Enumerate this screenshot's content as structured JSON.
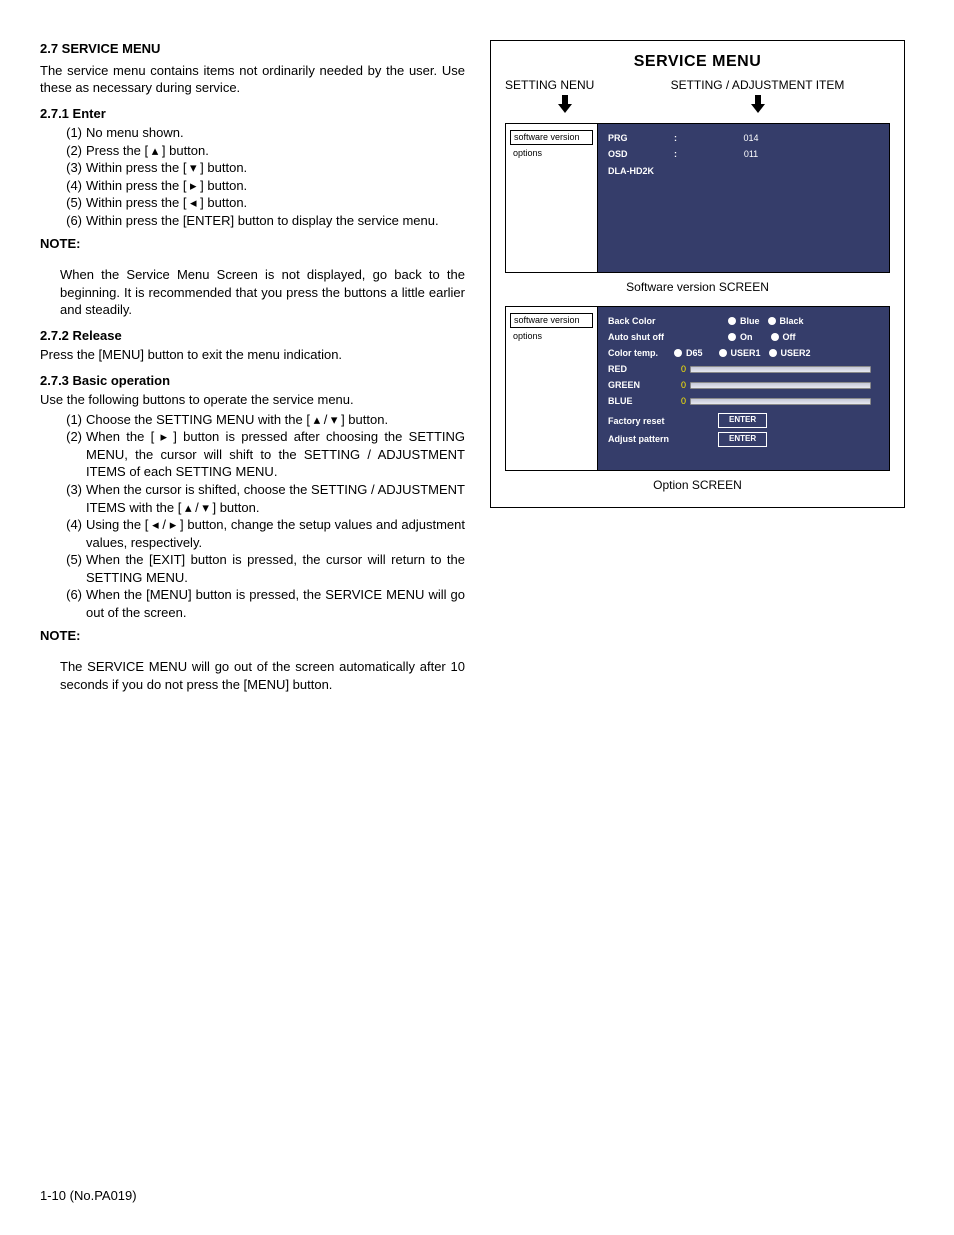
{
  "header": {
    "sec_num_title": "2.7   SERVICE MENU",
    "intro": "The service menu contains items not ordinarily needed by the user. Use these as necessary during service."
  },
  "sec271": {
    "title": "2.7.1   Enter",
    "steps": [
      "No menu shown.",
      "Press the [ ▴ ] button.",
      "Within press the [ ▾ ] button.",
      "Within press the [ ▸ ] button.",
      "Within press the [ ◂ ] button.",
      "Within press the [ENTER] button to display the service menu."
    ]
  },
  "note1": {
    "label": "NOTE:",
    "body": "When the Service Menu Screen is not displayed, go back to the beginning. It is recommended that you press the buttons a little earlier and steadily."
  },
  "sec272": {
    "title": "2.7.2   Release",
    "body": "Press the [MENU] button to exit the menu indication."
  },
  "sec273": {
    "title": "2.7.3   Basic operation",
    "lead": "Use the following buttons to operate the service menu.",
    "steps": [
      "Choose the SETTING MENU with the [ ▴ / ▾ ] button.",
      "When the [ ▸ ] button is pressed after choosing the SETTING MENU, the cursor will shift to the SETTING / ADJUSTMENT ITEMS of each SETTING MENU.",
      "When the cursor is shifted, choose the SETTING / ADJUSTMENT ITEMS with the [ ▴ / ▾ ] button.",
      "Using the [ ◂ / ▸ ] button, change the setup values and adjustment values, respectively.",
      "When the [EXIT] button is pressed, the cursor will return to the SETTING MENU.",
      "When the [MENU] button is pressed, the SERVICE MENU will go out of the screen."
    ]
  },
  "note2": {
    "label": "NOTE:",
    "body": "The SERVICE MENU will go out of the screen automatically after 10 seconds if you do not press the [MENU] button."
  },
  "footer": "1-10 (No.PA019)",
  "diagram": {
    "title": "SERVICE MENU",
    "col1": "SETTING NENU",
    "col2": "SETTING / ADJUSTMENT ITEM",
    "sidebar_items": [
      "software version",
      "options"
    ],
    "screen1": {
      "rows": [
        {
          "lbl": "PRG",
          "colon": ":",
          "val": "014"
        },
        {
          "lbl": "OSD",
          "colon": ":",
          "val": "011"
        },
        {
          "lbl": "DLA-HD2K",
          "colon": "",
          "val": ""
        }
      ],
      "caption": "Software version SCREEN"
    },
    "screen2": {
      "back_color": {
        "label": "Back Color",
        "opts": [
          "Blue",
          "Black"
        ]
      },
      "auto_shut": {
        "label": "Auto shut off",
        "opts": [
          "On",
          "Off"
        ]
      },
      "color_temp": {
        "label": "Color temp.",
        "opts": [
          "D65",
          "USER1",
          "USER2"
        ]
      },
      "sliders": [
        {
          "label": "RED",
          "val": "0"
        },
        {
          "label": "GREEN",
          "val": "0"
        },
        {
          "label": "BLUE",
          "val": "0"
        }
      ],
      "factory": {
        "label": "Factory reset",
        "btn": "ENTER"
      },
      "adjust": {
        "label": "Adjust pattern",
        "btn": "ENTER"
      },
      "caption": "Option SCREEN"
    }
  }
}
